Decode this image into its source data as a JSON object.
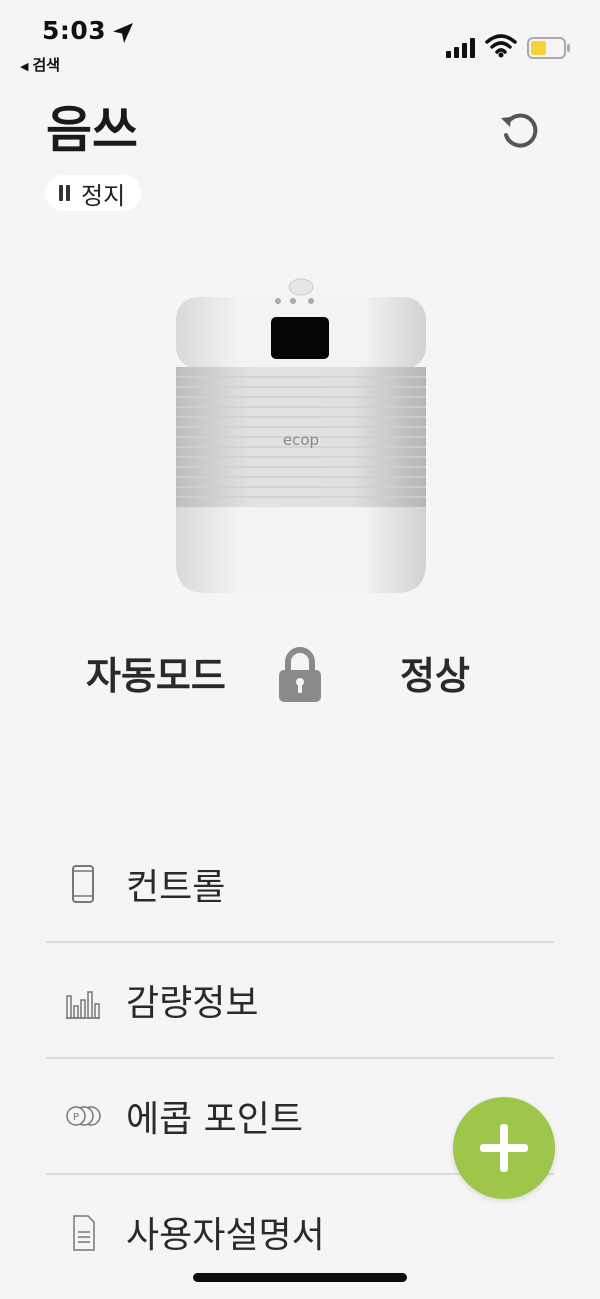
{
  "status_bar": {
    "time": "5:03",
    "back_app": "검색",
    "battery_color": "#f6d23a"
  },
  "header": {
    "title": "음쓰",
    "status_label": "정지"
  },
  "device": {
    "brand_mark": "ecop",
    "mode": "자동모드",
    "state": "정상"
  },
  "menu": {
    "items": [
      {
        "label": "컨트롤",
        "icon": "phone-icon"
      },
      {
        "label": "감량정보",
        "icon": "bar-chart-icon"
      },
      {
        "label": "에콥 포인트",
        "icon": "coins-icon"
      },
      {
        "label": "사용자설명서",
        "icon": "document-icon"
      }
    ]
  },
  "colors": {
    "accent": "#9dc64a",
    "background": "#f5f5f5"
  }
}
